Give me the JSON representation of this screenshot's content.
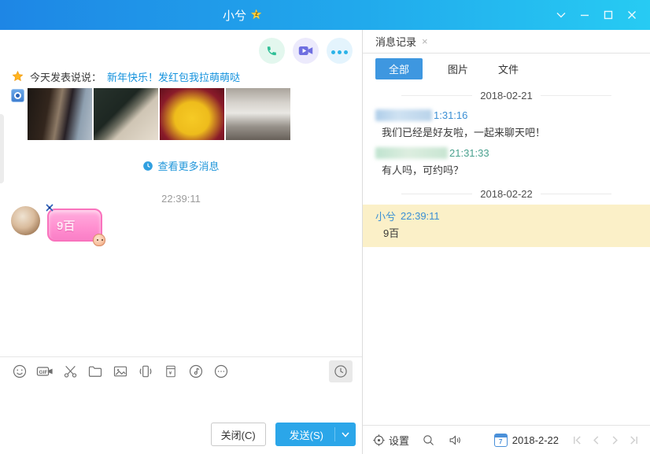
{
  "titlebar": {
    "title": "小兮",
    "badge_star": "★",
    "badge_letter": "z"
  },
  "left_panel": {
    "status_prefix": "今天发表说说：",
    "status_link": "新年快乐！发红包我拉萌萌哒",
    "photos": [
      {
        "alt": "woman sitting in elevator"
      },
      {
        "alt": "train window"
      },
      {
        "alt": "woman in yellow hoodie"
      },
      {
        "alt": "mall interior with railing"
      }
    ],
    "view_more": "查看更多消息",
    "time_divider": "22:39:11",
    "sticker_text": "9百",
    "buttons": {
      "close": "关闭(C)",
      "send": "发送(S)"
    },
    "toolbar_icons": [
      "emoji",
      "gif",
      "screenshot-scissors",
      "folder",
      "image",
      "shake-window",
      "red-packet",
      "audio-message",
      "more",
      "history-clock"
    ],
    "gif_label": "GIF",
    "red_packet_symbol": "¥"
  },
  "right_panel": {
    "tab_title": "消息记录",
    "tab_close": "×",
    "tabs": {
      "all": "全部",
      "images": "图片",
      "files": "文件"
    },
    "records": {
      "date1": "2018-02-21",
      "msg1_time": "1:31:16",
      "msg1_text": "我们已经是好友啦，一起来聊天吧！",
      "msg2_time": "21:31:33",
      "msg2_text": "有人吗，可约吗？",
      "date2": "2018-02-22",
      "msg3_sender": "小兮",
      "msg3_time": "22:39:11",
      "msg3_text": "9百"
    },
    "footer": {
      "settings": "设置",
      "calendar_day": "7",
      "date": "2018-2-22"
    }
  },
  "colors": {
    "titlebar_gradient_start": "#1e86e5",
    "titlebar_gradient_end": "#27cbf3",
    "active_tab_blue": "#3e97e0",
    "link_blue": "#1492dd",
    "time_blue": "#3b8fd4",
    "time_green": "#49a18e",
    "highlight_yellow": "#fbf0c8",
    "send_button_blue": "#2ba6e9",
    "sticker_pink": "#ff8fd0"
  }
}
